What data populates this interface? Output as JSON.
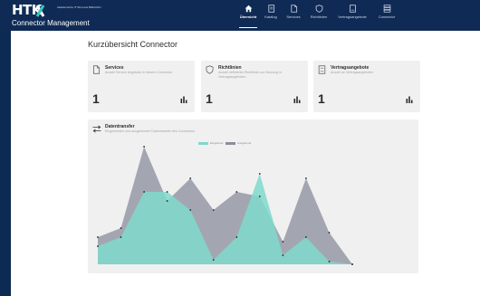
{
  "header": {
    "logo": "HTK",
    "logo_subtitle": "Akademische IT Wert aus Bildschirm",
    "app_title": "Connector Management"
  },
  "nav": {
    "items": [
      {
        "label": "Übersicht",
        "icon": "home-icon",
        "active": true
      },
      {
        "label": "Katalog",
        "icon": "document-icon",
        "active": false
      },
      {
        "label": "Services",
        "icon": "file-icon",
        "active": false
      },
      {
        "label": "Richtlinien",
        "icon": "shield-icon",
        "active": false
      },
      {
        "label": "Vertragsangebote",
        "icon": "contract-icon",
        "active": false
      },
      {
        "label": "Connector",
        "icon": "server-icon",
        "active": false
      }
    ]
  },
  "main": {
    "title": "Kurzübersicht Connector"
  },
  "cards": [
    {
      "title": "Services",
      "description": "Anzahl Service Angebote in diesem Connector",
      "count": "1",
      "icon": "file-icon"
    },
    {
      "title": "Richtlinien",
      "description": "Anzahl definierter Richtlinien zur Nutzung in Vertragsangeboten",
      "count": "1",
      "icon": "shield-icon"
    },
    {
      "title": "Vertragsangebote",
      "description": "Anzahl an Vertragsangeboten",
      "count": "1",
      "icon": "contract-icon"
    }
  ],
  "transfer": {
    "title": "Datentransfer",
    "description": "Eingehenden und ausgehender Datentransfer des Connectors",
    "icon": "transfer-arrows-icon"
  },
  "colors": {
    "navy": "#0f2b55",
    "incoming": "#7fd9cc",
    "outgoing": "#8a8d9c"
  },
  "chart_data": {
    "type": "area",
    "x": [
      1,
      2,
      3,
      4,
      5,
      6,
      7,
      8,
      9,
      10,
      11,
      12
    ],
    "series": [
      {
        "name": "Eingehend",
        "values": [
          20,
          30,
          80,
          80,
          60,
          5,
          30,
          100,
          10,
          30,
          3,
          0
        ]
      },
      {
        "name": "Ausgehend",
        "values": [
          30,
          40,
          130,
          70,
          95,
          60,
          80,
          75,
          25,
          95,
          35,
          0
        ]
      }
    ],
    "ylim": [
      0,
      140
    ],
    "grid": false,
    "legend_placement": "top-center"
  }
}
